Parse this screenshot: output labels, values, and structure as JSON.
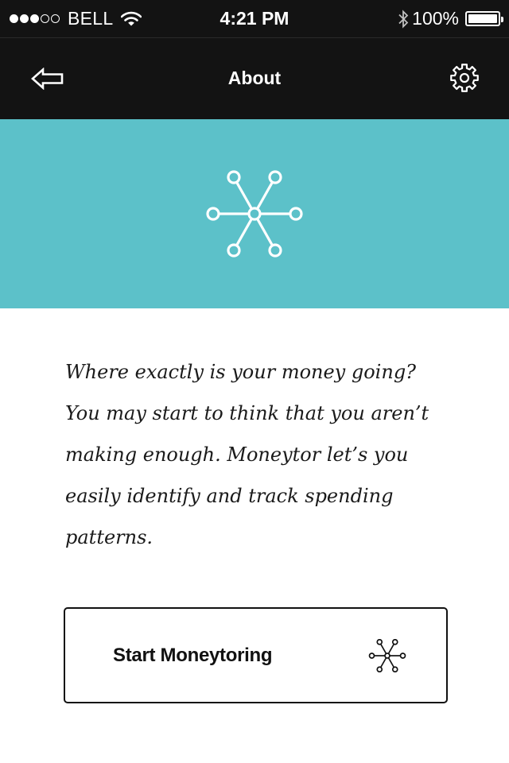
{
  "status_bar": {
    "signal_dots": [
      "filled",
      "filled",
      "filled",
      "empty",
      "empty"
    ],
    "carrier": "BELL",
    "wifi_icon": "wifi-icon",
    "time": "4:21 PM",
    "bluetooth_icon": "bluetooth-icon",
    "battery_percent": "100%",
    "battery_level": 1.0
  },
  "nav": {
    "back_icon": "back-arrow-icon",
    "title": "About",
    "settings_icon": "gear-icon"
  },
  "hero": {
    "icon": "network-node-icon",
    "background_color": "#5cc1c9"
  },
  "description": "Where exactly is your money going? You may start to think that you aren’t making enough. Moneytor let’s you easily identify and track spending patterns.",
  "start_button": {
    "label": "Start Moneytoring",
    "icon": "network-node-icon"
  }
}
